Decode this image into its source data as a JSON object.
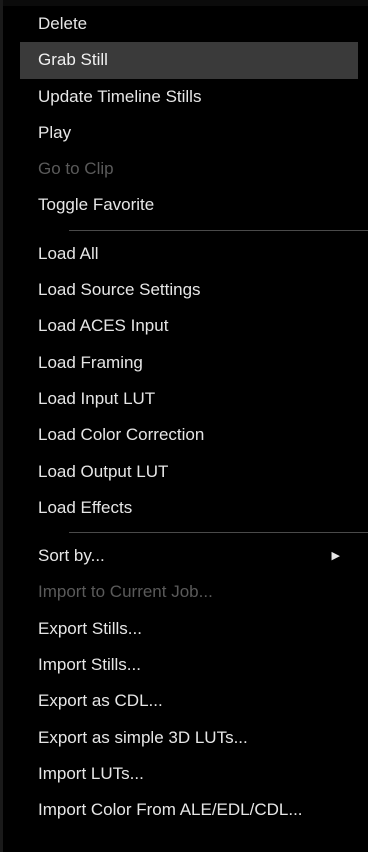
{
  "menu": {
    "groups": [
      [
        {
          "label": "Delete",
          "disabled": false
        },
        {
          "label": "Grab Still",
          "disabled": false,
          "highlighted": true
        },
        {
          "label": "Update Timeline Stills",
          "disabled": false
        },
        {
          "label": "Play",
          "disabled": false
        },
        {
          "label": "Go to Clip",
          "disabled": true
        },
        {
          "label": "Toggle Favorite",
          "disabled": false
        }
      ],
      [
        {
          "label": "Load All",
          "disabled": false
        },
        {
          "label": "Load Source Settings",
          "disabled": false
        },
        {
          "label": "Load ACES Input",
          "disabled": false
        },
        {
          "label": "Load Framing",
          "disabled": false
        },
        {
          "label": "Load Input LUT",
          "disabled": false
        },
        {
          "label": "Load Color Correction",
          "disabled": false
        },
        {
          "label": "Load Output LUT",
          "disabled": false
        },
        {
          "label": "Load Effects",
          "disabled": false
        }
      ],
      [
        {
          "label": "Sort by...",
          "disabled": false,
          "submenu": true
        },
        {
          "label": "Import to Current Job...",
          "disabled": true
        },
        {
          "label": "Export Stills...",
          "disabled": false
        },
        {
          "label": "Import Stills...",
          "disabled": false
        },
        {
          "label": "Export as CDL...",
          "disabled": false
        },
        {
          "label": "Export as simple 3D LUTs...",
          "disabled": false
        },
        {
          "label": "Import LUTs...",
          "disabled": false
        },
        {
          "label": "Import Color From ALE/EDL/CDL...",
          "disabled": false
        }
      ]
    ],
    "submenu_icon": "chevron-right-icon"
  }
}
